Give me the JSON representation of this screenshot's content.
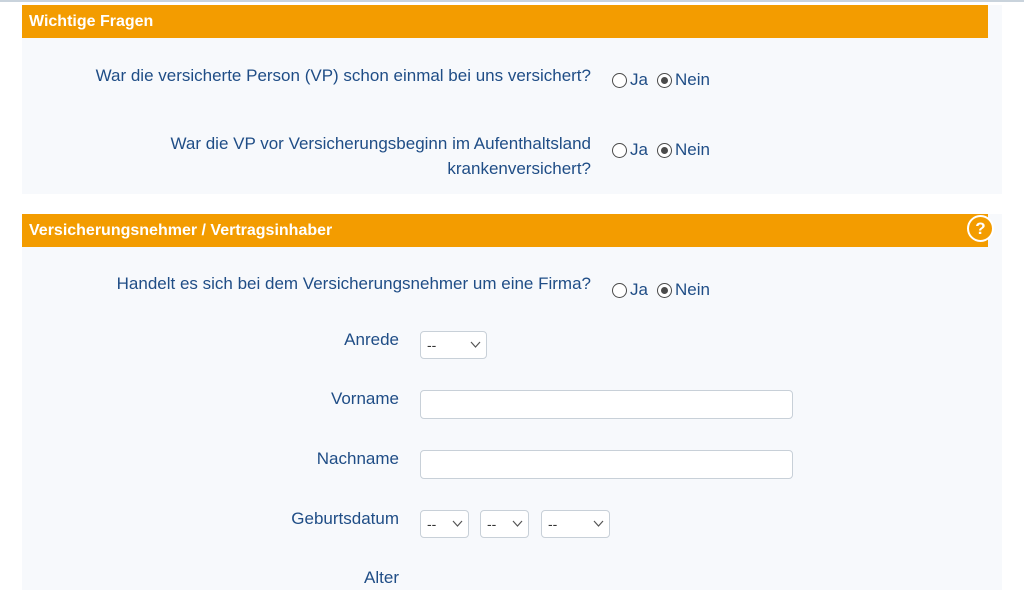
{
  "section1": {
    "title": "Wichtige Fragen",
    "questions": [
      {
        "label": "War die versicherte Person (VP) schon einmal bei uns versichert?",
        "options": [
          "Ja",
          "Nein"
        ],
        "selected": "Nein"
      },
      {
        "label_line1": "War die VP vor Versicherungsbeginn im Aufenthaltsland",
        "label_line2": "krankenversichert?",
        "options": [
          "Ja",
          "Nein"
        ],
        "selected": "Nein"
      }
    ]
  },
  "section2": {
    "title": "Versicherungsnehmer / Vertragsinhaber",
    "help_icon": "question-circle-icon",
    "help_glyph": "?",
    "firma_question": {
      "label": "Handelt es sich bei dem Versicherungsnehmer um eine Firma?",
      "options": [
        "Ja",
        "Nein"
      ],
      "selected": "Nein"
    },
    "anrede": {
      "label": "Anrede",
      "value": "--"
    },
    "vorname": {
      "label": "Vorname",
      "value": ""
    },
    "nachname": {
      "label": "Nachname",
      "value": ""
    },
    "geburtsdatum": {
      "label": "Geburtsdatum",
      "day": "--",
      "month": "--",
      "year": "--"
    },
    "alter": {
      "label": "Alter"
    }
  },
  "icons": {
    "chevron": "chevron-down-icon"
  },
  "colors": {
    "header_bg": "#f39c00",
    "label_text": "#1f4d86",
    "panel_bg": "#f7f9fc"
  }
}
